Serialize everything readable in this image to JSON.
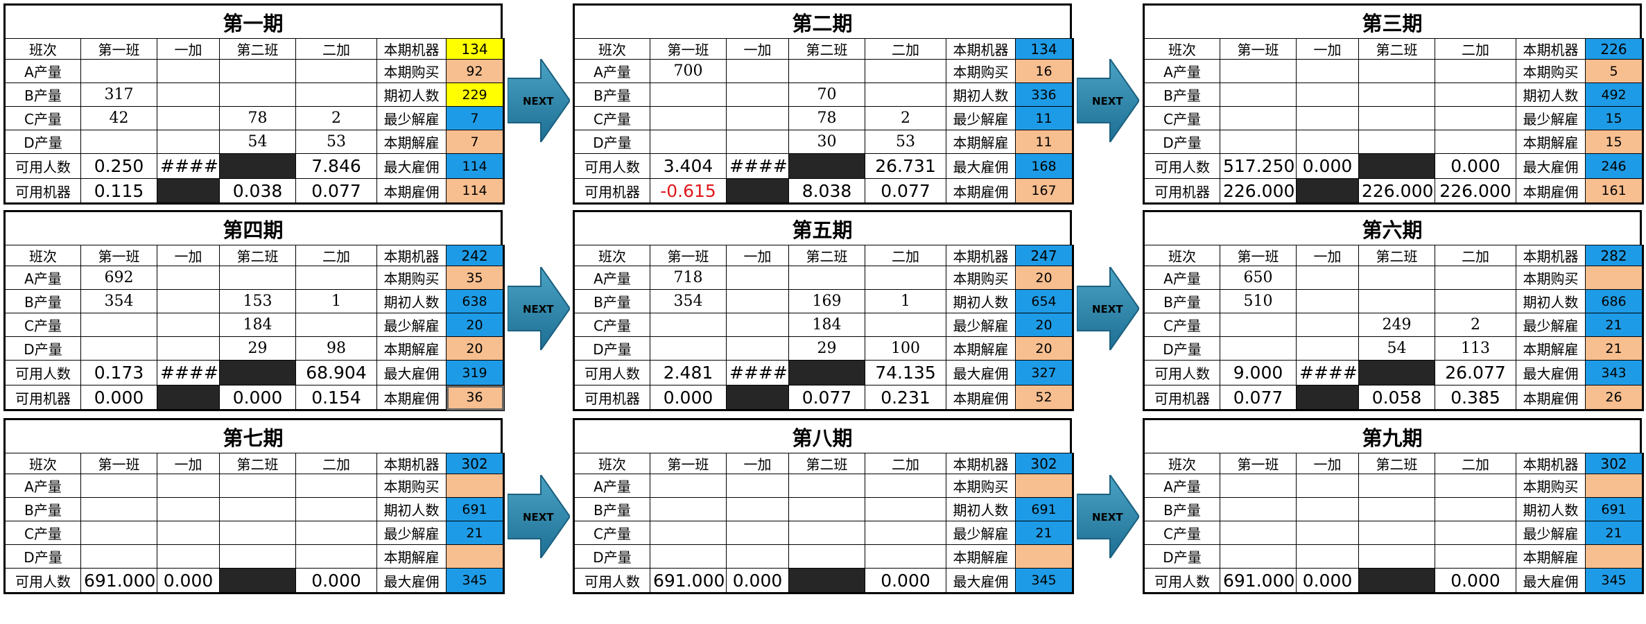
{
  "header_labels": [
    "班次",
    "第一班",
    "一加",
    "第二班",
    "二加"
  ],
  "row_labels": [
    "A产量",
    "B产量",
    "C产量",
    "D产量",
    "可用人数",
    "可用机器"
  ],
  "right_labels": [
    "本期机器",
    "本期购买",
    "期初人数",
    "最少解雇",
    "本期解雇",
    "最大雇佣",
    "本期雇佣"
  ],
  "next_label": "NEXT",
  "colors": {
    "yellow": "#ffff00",
    "blue": "#1e9be6",
    "peach": "#f7be8f",
    "dark": "#262626",
    "red": "#e0181b"
  },
  "periods": [
    {
      "title": "第一期",
      "cells": [
        [
          "",
          "",
          "",
          ""
        ],
        [
          "317",
          "",
          "",
          ""
        ],
        [
          "42",
          "",
          "78",
          "2"
        ],
        [
          "",
          "",
          "54",
          "53"
        ],
        [
          "0.250",
          "#####",
          "",
          "7.846"
        ],
        [
          "0.115",
          "",
          "0.038",
          "0.077"
        ]
      ],
      "right": [
        "134",
        "92",
        "229",
        "7",
        "7",
        "114",
        "114"
      ]
    },
    {
      "title": "第二期",
      "cells": [
        [
          "700",
          "",
          "",
          ""
        ],
        [
          "",
          "",
          "70",
          ""
        ],
        [
          "",
          "",
          "78",
          "2"
        ],
        [
          "",
          "",
          "30",
          "53"
        ],
        [
          "3.404",
          "#####",
          "",
          "26.731"
        ],
        [
          "-0.615",
          "",
          "8.038",
          "0.077"
        ]
      ],
      "right": [
        "134",
        "16",
        "336",
        "11",
        "11",
        "168",
        "167"
      ]
    },
    {
      "title": "第三期",
      "cells": [
        [
          "",
          "",
          "",
          ""
        ],
        [
          "",
          "",
          "",
          ""
        ],
        [
          "",
          "",
          "",
          ""
        ],
        [
          "",
          "",
          "",
          ""
        ],
        [
          "517.250",
          "0.000",
          "",
          "0.000"
        ],
        [
          "226.000",
          "",
          "226.000",
          "226.000"
        ]
      ],
      "right": [
        "226",
        "5",
        "492",
        "15",
        "15",
        "246",
        "161"
      ]
    },
    {
      "title": "第四期",
      "cells": [
        [
          "692",
          "",
          "",
          ""
        ],
        [
          "354",
          "",
          "153",
          "1"
        ],
        [
          "",
          "",
          "184",
          ""
        ],
        [
          "",
          "",
          "29",
          "98"
        ],
        [
          "0.173",
          "#####",
          "",
          "68.904"
        ],
        [
          "0.000",
          "",
          "0.000",
          "0.154"
        ]
      ],
      "right": [
        "242",
        "35",
        "638",
        "20",
        "20",
        "319",
        "36"
      ]
    },
    {
      "title": "第五期",
      "cells": [
        [
          "718",
          "",
          "",
          ""
        ],
        [
          "354",
          "",
          "169",
          "1"
        ],
        [
          "",
          "",
          "184",
          ""
        ],
        [
          "",
          "",
          "29",
          "100"
        ],
        [
          "2.481",
          "#####",
          "",
          "74.135"
        ],
        [
          "0.000",
          "",
          "0.077",
          "0.231"
        ]
      ],
      "right": [
        "247",
        "20",
        "654",
        "20",
        "20",
        "327",
        "52"
      ]
    },
    {
      "title": "第六期",
      "cells": [
        [
          "650",
          "",
          "",
          ""
        ],
        [
          "510",
          "",
          "",
          ""
        ],
        [
          "",
          "",
          "249",
          "2"
        ],
        [
          "",
          "",
          "54",
          "113"
        ],
        [
          "9.000",
          "#####",
          "",
          "26.077"
        ],
        [
          "0.077",
          "",
          "0.058",
          "0.385"
        ]
      ],
      "right": [
        "282",
        "",
        "686",
        "21",
        "21",
        "343",
        "26"
      ]
    },
    {
      "title": "第七期",
      "cells": [
        [
          "",
          "",
          "",
          ""
        ],
        [
          "",
          "",
          "",
          ""
        ],
        [
          "",
          "",
          "",
          ""
        ],
        [
          "",
          "",
          "",
          ""
        ],
        [
          "691.000",
          "0.000",
          "",
          "0.000"
        ]
      ],
      "right": [
        "302",
        "",
        "691",
        "21",
        "",
        "345"
      ]
    },
    {
      "title": "第八期",
      "cells": [
        [
          "",
          "",
          "",
          ""
        ],
        [
          "",
          "",
          "",
          ""
        ],
        [
          "",
          "",
          "",
          ""
        ],
        [
          "",
          "",
          "",
          ""
        ],
        [
          "691.000",
          "0.000",
          "",
          "0.000"
        ]
      ],
      "right": [
        "302",
        "",
        "691",
        "21",
        "",
        "345"
      ]
    },
    {
      "title": "第九期",
      "cells": [
        [
          "",
          "",
          "",
          ""
        ],
        [
          "",
          "",
          "",
          ""
        ],
        [
          "",
          "",
          "",
          ""
        ],
        [
          "",
          "",
          "",
          ""
        ],
        [
          "691.000",
          "0.000",
          "",
          "0.000"
        ]
      ],
      "right": [
        "302",
        "",
        "691",
        "21",
        "",
        "345"
      ]
    }
  ]
}
